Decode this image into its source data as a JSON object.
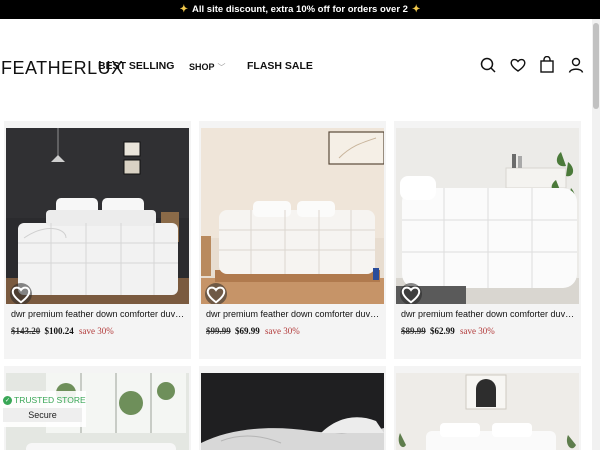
{
  "announcement": {
    "icon": "sparkle-icon",
    "text": "All site discount, extra 10% off for orders over 2"
  },
  "header": {
    "logo": "FEATHERLUX",
    "nav": {
      "best_selling": "BEST SELLING",
      "shop": "SHOP",
      "flash_sale": "FLASH SALE"
    },
    "icons": [
      "search-icon",
      "heart-icon",
      "bag-icon",
      "user-icon"
    ]
  },
  "products": [
    {
      "title": "dwr premium feather down comforter duvet insert",
      "old_price": "$143.20",
      "new_price": "$100.24",
      "save": "save 30%"
    },
    {
      "title": "dwr premium feather down comforter duvet insert",
      "old_price": "$99.99",
      "new_price": "$69.99",
      "save": "save 30%"
    },
    {
      "title": "dwr premium feather down comforter duvet insert",
      "old_price": "$89.99",
      "new_price": "$62.99",
      "save": "save 30%"
    }
  ],
  "trust_badge": {
    "label": "TRUSTED STORE",
    "sub": "Secure"
  },
  "colors": {
    "announcement_bg": "#000000",
    "sale_text": "#b23a3a",
    "trusted_green": "#3aa757",
    "card_bg": "#f4f4f4"
  }
}
